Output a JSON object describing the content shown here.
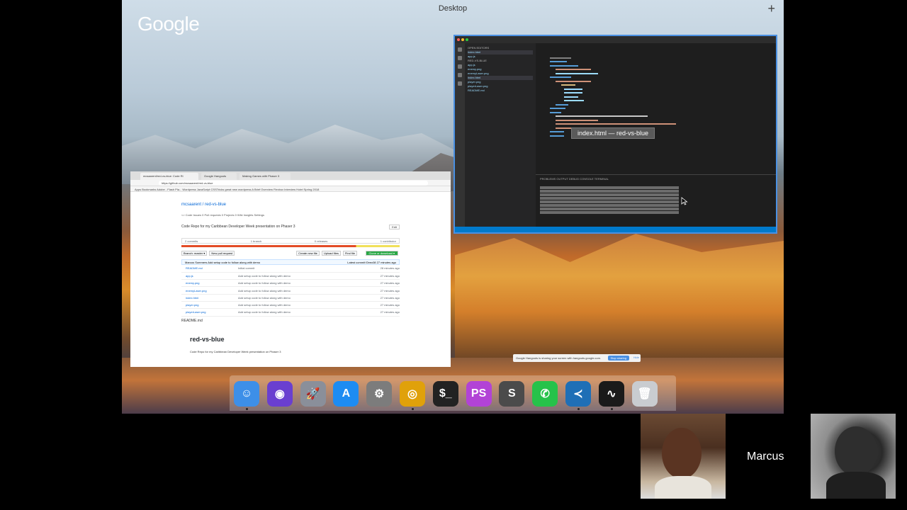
{
  "desktop": {
    "title": "Desktop",
    "add_symbol": "+",
    "google_logo": "Google"
  },
  "vscode": {
    "tooltip": "index.html — red-vs-blue",
    "explorer_items": [
      "OPEN EDITORS",
      "index.html",
      "app.js",
      "RED-VS-BLUE",
      "app.js",
      "enemy.png",
      "enemyLaser.png",
      "index.html",
      "player.png",
      "playerLaser.png",
      "README.md"
    ],
    "panel_tabs": "PROBLEMS   OUTPUT   DEBUG CONSOLE   TERMINAL",
    "accent": "#007acc"
  },
  "chrome": {
    "tabs": [
      "mcsaarent/red-vs-blue: Code Ri",
      "Google Hangouts",
      "Making Games with Phaser 3"
    ],
    "url": "https://github.com/mcsaarent/red-vs-blue",
    "bookmarks": "Apps   Bookmarks   Adobe - Flash Pla...   Wordpress   JavaScript   CSSTricks   great new wordpress   A Brief Overview   Flexbox Interview   Hotel Spring 2018"
  },
  "github": {
    "repo": "mcsaarent / red-vs-blue",
    "tabs": "<> Code    Issues 0    Pull requests 0    Projects 0    Wiki    Insights    Settings",
    "description": "Code Repo for my Caribbean Developer Week presentation on Phaser 3",
    "edit_label": "Edit",
    "stats": [
      "2 commits",
      "1 branch",
      "0 releases",
      "1 contributor"
    ],
    "branch_label": "Branch: master ▾",
    "new_pr_label": "New pull request",
    "create_file_label": "Create new file",
    "upload_label": "Upload files",
    "find_label": "Find file",
    "clone_label": "Clone or download ▾",
    "commit_text": "Marcus Sommers Add setup code to follow along with demo",
    "commit_meta": "Latest commit f2eec08  27 minutes ago",
    "files": [
      {
        "name": "README.md",
        "msg": "Initial commit",
        "age": "28 minutes ago"
      },
      {
        "name": "app.js",
        "msg": "Add setup code to follow along with demo",
        "age": "27 minutes ago"
      },
      {
        "name": "enemy.png",
        "msg": "Add setup code to follow along with demo",
        "age": "27 minutes ago"
      },
      {
        "name": "enemyLaser.png",
        "msg": "Add setup code to follow along with demo",
        "age": "27 minutes ago"
      },
      {
        "name": "index.html",
        "msg": "Add setup code to follow along with demo",
        "age": "27 minutes ago"
      },
      {
        "name": "player.png",
        "msg": "Add setup code to follow along with demo",
        "age": "27 minutes ago"
      },
      {
        "name": "playerLaser.png",
        "msg": "Add setup code to follow along with demo",
        "age": "27 minutes ago"
      }
    ],
    "readme_label": "README.md",
    "readme_title": "red-vs-blue",
    "readme_text": "Code Repo for my Caribbean Developer Week presentation on Phaser 3"
  },
  "share_notice": {
    "text": "Google Hangouts is sharing your screen with hangouts.google.com.",
    "stop_label": "Stop sharing",
    "hide_label": "Hide"
  },
  "dock": [
    {
      "name": "finder-icon",
      "color": "#3d8fe8",
      "glyph": "☺"
    },
    {
      "name": "siri-icon",
      "color": "#6a3fd0",
      "glyph": "◉"
    },
    {
      "name": "launchpad-icon",
      "color": "#8a8f9a",
      "glyph": "🚀"
    },
    {
      "name": "app-store-icon",
      "color": "#1d8cf2",
      "glyph": "A"
    },
    {
      "name": "system-preferences-icon",
      "color": "#7c7c7c",
      "glyph": "⚙"
    },
    {
      "name": "chrome-icon",
      "color": "#e0a10a",
      "glyph": "◎"
    },
    {
      "name": "terminal-icon",
      "color": "#222222",
      "glyph": "$_"
    },
    {
      "name": "phpstorm-icon",
      "color": "#b243d6",
      "glyph": "PS"
    },
    {
      "name": "sublime-text-icon",
      "color": "#4b4b4b",
      "glyph": "S"
    },
    {
      "name": "whatsapp-icon",
      "color": "#26c24a",
      "glyph": "✆"
    },
    {
      "name": "vscode-icon",
      "color": "#1f6fb6",
      "glyph": "≺"
    },
    {
      "name": "activity-monitor-icon",
      "color": "#1a1a1a",
      "glyph": "∿"
    },
    {
      "name": "trash-icon",
      "color": "#c9ccd0",
      "glyph": "🗑"
    }
  ],
  "participants": {
    "name": "Marcus"
  }
}
